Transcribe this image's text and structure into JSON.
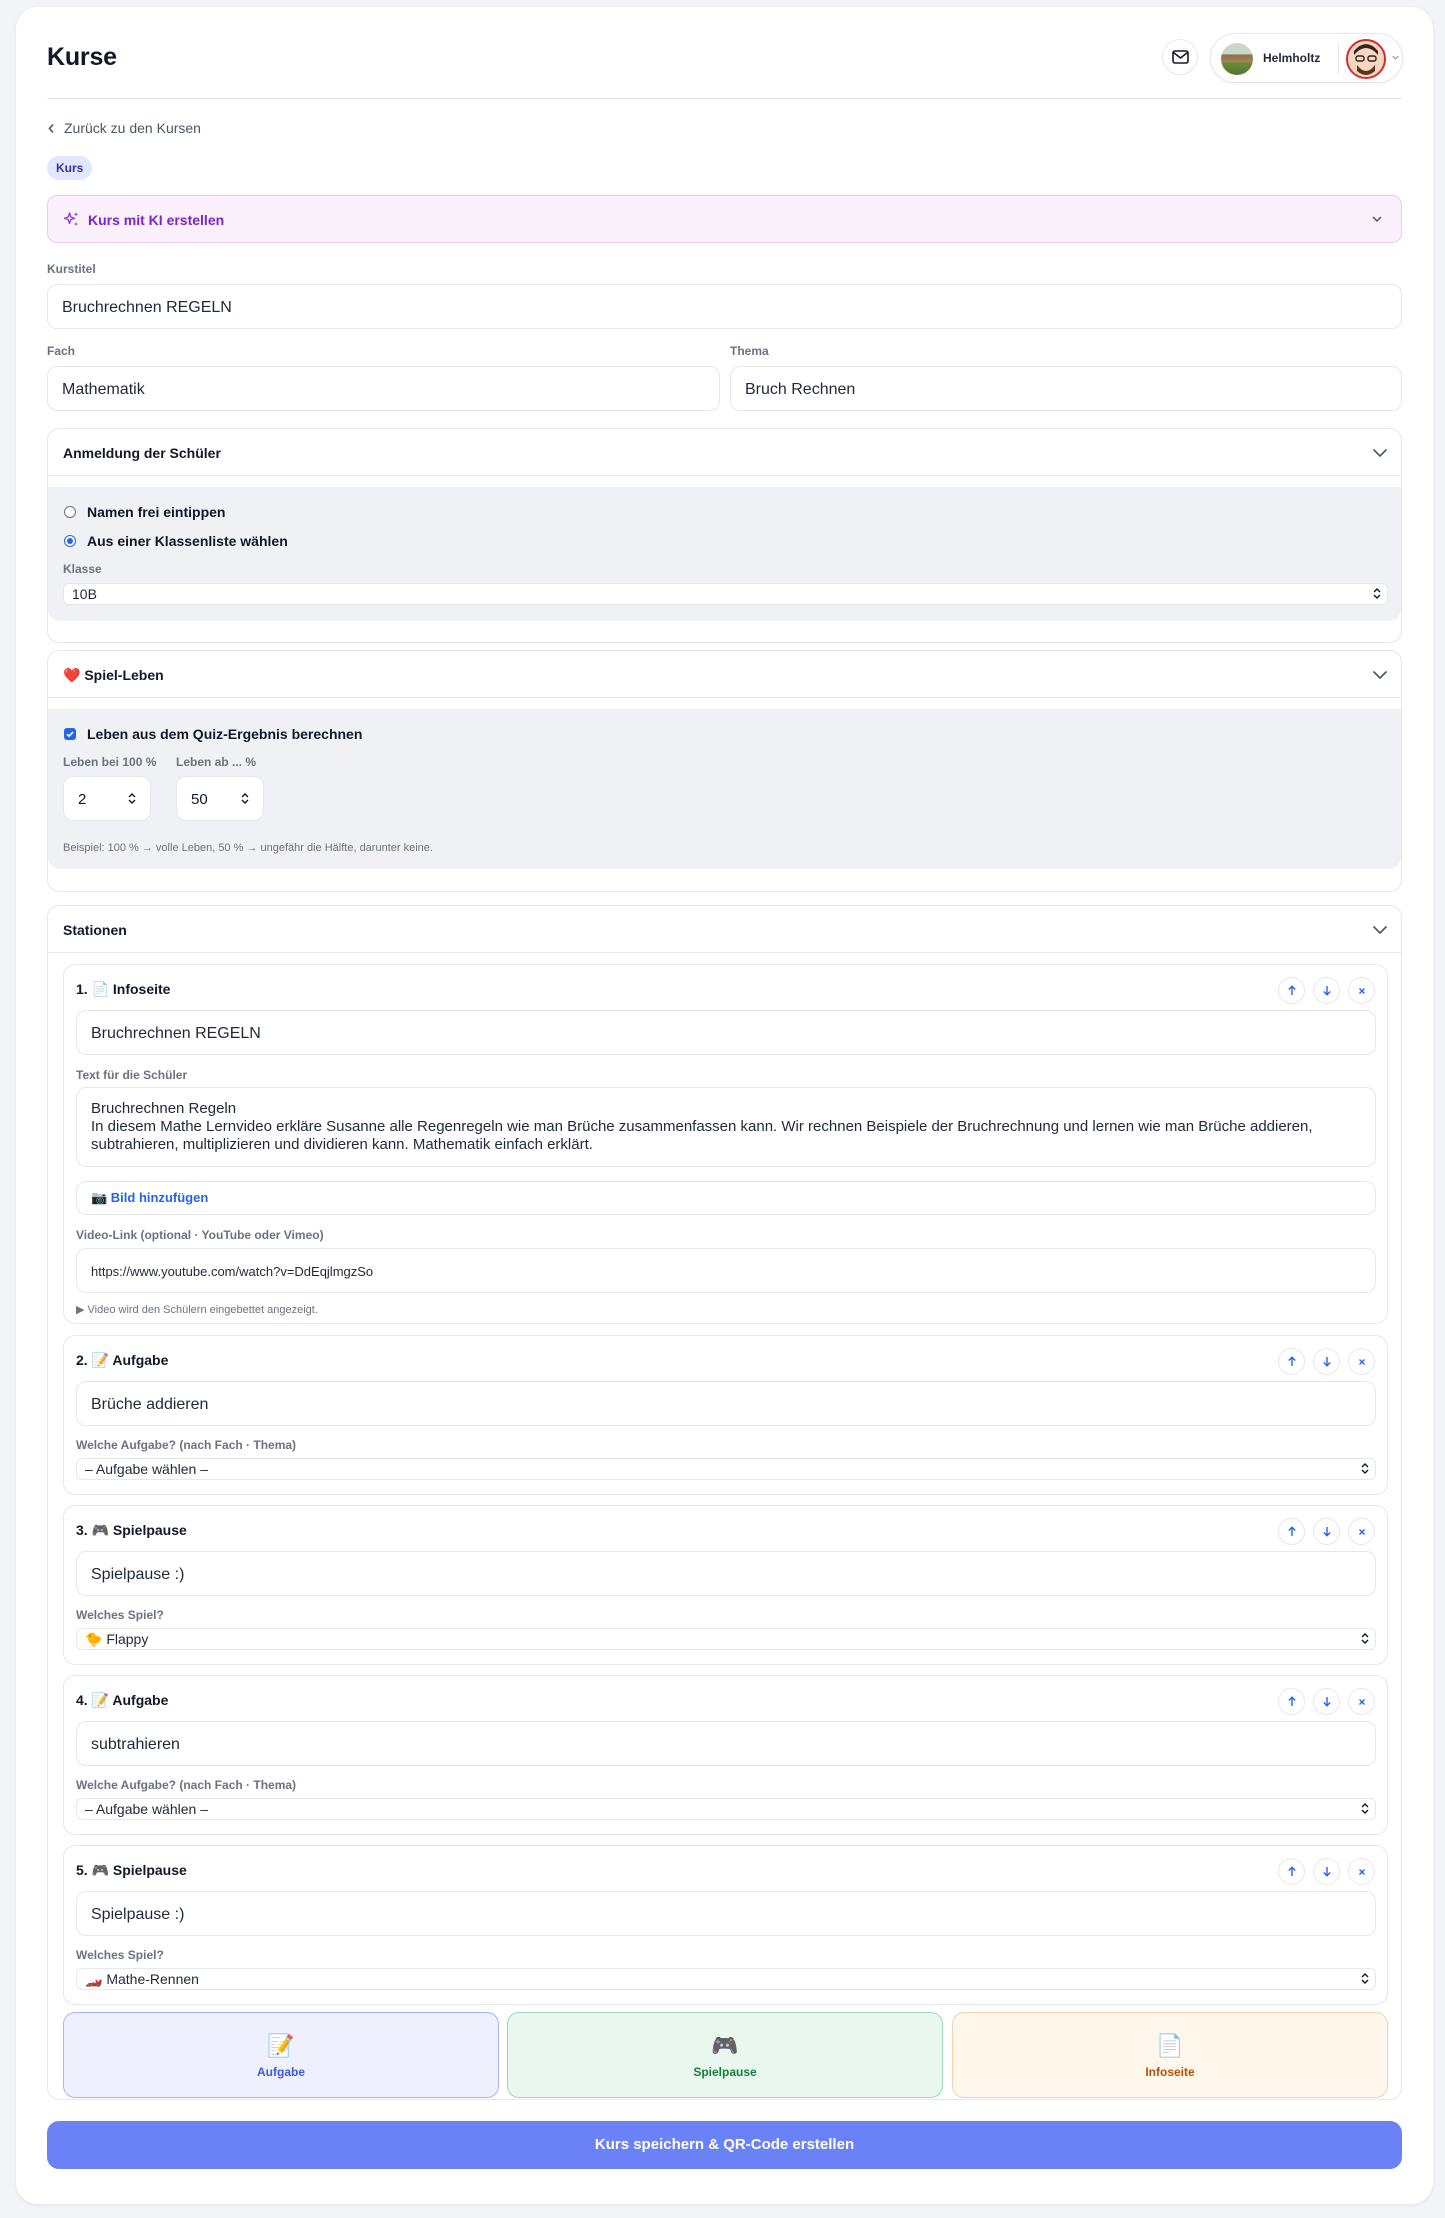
{
  "header": {
    "title": "Kurse",
    "school_name": "Helmholtz"
  },
  "back_link": "Zurück zu den Kursen",
  "badge": "Kurs",
  "ai_box": {
    "label": "Kurs mit KI erstellen"
  },
  "fields": {
    "course_title_label": "Kurstitel",
    "course_title": "Bruchrechnen REGELN",
    "subject_label": "Fach",
    "subject": "Mathematik",
    "topic_label": "Thema",
    "topic": "Bruch Rechnen"
  },
  "login_section": {
    "title": "Anmeldung der Schüler",
    "option_free": "Namen frei eintippen",
    "option_list": "Aus einer Klassenliste wählen",
    "class_label": "Klasse",
    "class_value": "10B"
  },
  "lives_section": {
    "title": "Spiel-Leben",
    "icon": "❤️",
    "checkbox_label": "Leben aus dem Quiz-Ergebnis berechnen",
    "lives_at_100_label": "Leben bei 100 %",
    "lives_at_100": "2",
    "lives_from_label": "Leben ab ... %",
    "lives_from": "50",
    "hint": "Beispiel: 100 % → volle Leben, 50 % → ungefähr die Hälfte, darunter keine."
  },
  "stations_section": {
    "title": "Stationen",
    "stations": [
      {
        "title": "1. 📄 Infoseite",
        "input": "Bruchrechnen REGELN",
        "text_label": "Text für die Schüler",
        "text_line1": "Bruchrechnen Regeln",
        "text_line2": "In diesem Mathe Lernvideo erkläre Susanne alle Regenregeln wie man Brüche zusammenfassen kann. Wir rechnen Beispiele der Bruchrechnung und lernen wie man Brüche addieren, subtrahieren, multiplizieren und dividieren kann. Mathematik einfach erklärt.",
        "image_button": "📷 Bild hinzufügen",
        "video_label": "Video-Link (optional · YouTube oder Vimeo)",
        "video_url": "https://www.youtube.com/watch?v=DdEqjlmgzSo",
        "video_hint": "▶ Video wird den Schülern eingebettet angezeigt."
      },
      {
        "title": "2. 📝 Aufgabe",
        "input": "Brüche addieren",
        "select_label": "Welche Aufgabe? (nach Fach · Thema)",
        "select_value": "– Aufgabe wählen –"
      },
      {
        "title": "3. 🎮 Spielpause",
        "input": "Spielpause :)",
        "select_label": "Welches Spiel?",
        "select_value": "🐤 Flappy"
      },
      {
        "title": "4. 📝 Aufgabe",
        "input": "subtrahieren",
        "select_label": "Welche Aufgabe? (nach Fach · Thema)",
        "select_value": "– Aufgabe wählen –"
      },
      {
        "title": "5. 🎮 Spielpause",
        "input": "Spielpause :)",
        "select_label": "Welches Spiel?",
        "select_value": "🏎️ Mathe-Rennen"
      }
    ],
    "add_tiles": [
      {
        "icon": "📝",
        "label": "Aufgabe",
        "bg": "#eef1fd",
        "border": "#a5b4fc",
        "color": "#3b5bdb"
      },
      {
        "icon": "🎮",
        "label": "Spielpause",
        "bg": "#eaf7ef",
        "border": "#9fd8b4",
        "color": "#15803d"
      },
      {
        "icon": "📄",
        "label": "Infoseite",
        "bg": "#fff6ec",
        "border": "#f7d2a4",
        "color": "#b45309"
      }
    ]
  },
  "save_button": "Kurs speichern & QR-Code erstellen"
}
